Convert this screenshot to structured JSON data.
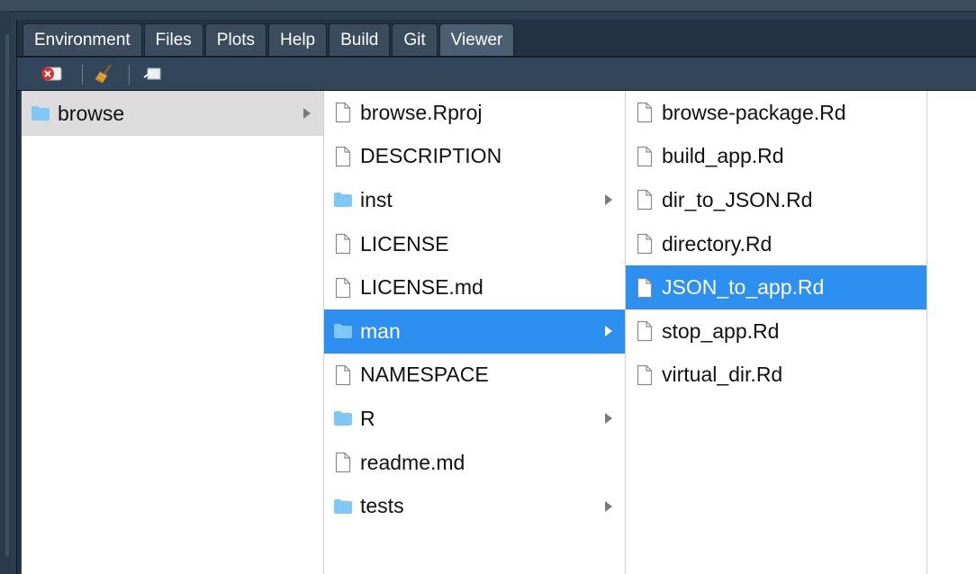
{
  "tabs": [
    {
      "label": "Environment",
      "active": false
    },
    {
      "label": "Files",
      "active": false
    },
    {
      "label": "Plots",
      "active": false
    },
    {
      "label": "Help",
      "active": false
    },
    {
      "label": "Build",
      "active": false
    },
    {
      "label": "Git",
      "active": false
    },
    {
      "label": "Viewer",
      "active": true
    }
  ],
  "toolbar": {
    "buttons": [
      {
        "name": "remove-viewer-item-button",
        "icon": "close-x-icon"
      },
      {
        "name": "clear-all-button",
        "icon": "broom-icon"
      },
      {
        "name": "popout-button",
        "icon": "popout-window-icon"
      }
    ]
  },
  "columns": [
    {
      "items": [
        {
          "label": "browse",
          "type": "folder",
          "selected": "gray"
        }
      ]
    },
    {
      "items": [
        {
          "label": "browse.Rproj",
          "type": "file"
        },
        {
          "label": "DESCRIPTION",
          "type": "file"
        },
        {
          "label": "inst",
          "type": "folder"
        },
        {
          "label": "LICENSE",
          "type": "file"
        },
        {
          "label": "LICENSE.md",
          "type": "file"
        },
        {
          "label": "man",
          "type": "folder",
          "selected": "blue"
        },
        {
          "label": "NAMESPACE",
          "type": "file"
        },
        {
          "label": "R",
          "type": "folder"
        },
        {
          "label": "readme.md",
          "type": "file"
        },
        {
          "label": "tests",
          "type": "folder"
        }
      ]
    },
    {
      "items": [
        {
          "label": "browse-package.Rd",
          "type": "file"
        },
        {
          "label": "build_app.Rd",
          "type": "file"
        },
        {
          "label": "dir_to_JSON.Rd",
          "type": "file"
        },
        {
          "label": "directory.Rd",
          "type": "file"
        },
        {
          "label": "JSON_to_app.Rd",
          "type": "file",
          "selected": "blue"
        },
        {
          "label": "stop_app.Rd",
          "type": "file"
        },
        {
          "label": "virtual_dir.Rd",
          "type": "file"
        }
      ]
    }
  ],
  "colors": {
    "selection_blue": "#2d8fef",
    "selection_gray": "#dcdcdc",
    "folder_blue": "#7fc8f5"
  }
}
